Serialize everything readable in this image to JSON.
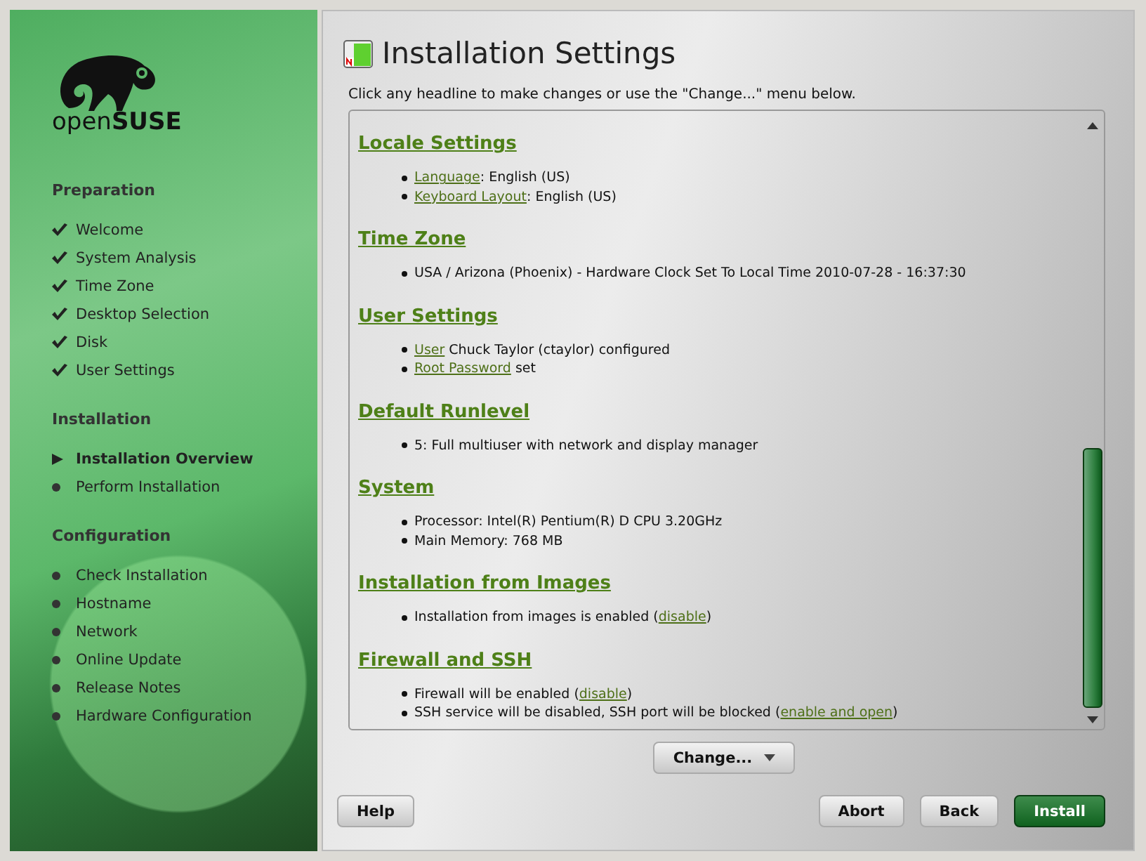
{
  "sidebar": {
    "logo_text": "open**SUSE**",
    "groups": [
      {
        "title": "Preparation",
        "items": [
          {
            "label": "Welcome",
            "checked": true,
            "selected": false
          },
          {
            "label": "System Analysis",
            "checked": true,
            "selected": false
          },
          {
            "label": "Time Zone",
            "checked": true,
            "selected": false
          },
          {
            "label": "Desktop Selection",
            "checked": true,
            "selected": false
          },
          {
            "label": "Disk",
            "checked": true,
            "selected": false
          },
          {
            "label": "User Settings",
            "checked": true,
            "selected": false
          }
        ]
      },
      {
        "title": "Installation",
        "items": [
          {
            "label": "Installation Overview",
            "checked": false,
            "selected": true
          },
          {
            "label": "Perform Installation",
            "checked": false,
            "selected": false
          }
        ]
      },
      {
        "title": "Configuration",
        "items": [
          {
            "label": "Check Installation",
            "checked": false,
            "selected": false
          },
          {
            "label": "Hostname",
            "checked": false,
            "selected": false
          },
          {
            "label": "Network",
            "checked": false,
            "selected": false
          },
          {
            "label": "Online Update",
            "checked": false,
            "selected": false
          },
          {
            "label": "Release Notes",
            "checked": false,
            "selected": false
          },
          {
            "label": "Hardware Configuration",
            "checked": false,
            "selected": false
          }
        ]
      }
    ]
  },
  "title": "Installation Settings",
  "hint": "Click any headline to make changes or use the \"Change...\" menu below.",
  "sections": [
    {
      "heading": "Locale Settings",
      "items": [
        [
          {
            "text": "Language",
            "link": true
          },
          {
            "text": ": English (US)",
            "link": false
          }
        ],
        [
          {
            "text": "Keyboard Layout",
            "link": true
          },
          {
            "text": ": English (US)",
            "link": false
          }
        ]
      ]
    },
    {
      "heading": "Time Zone",
      "items": [
        [
          {
            "text": "USA / Arizona (Phoenix) - Hardware Clock Set To Local Time 2010-07-28 - 16:37:30",
            "link": false
          }
        ]
      ]
    },
    {
      "heading": "User Settings",
      "items": [
        [
          {
            "text": "User",
            "link": true
          },
          {
            "text": " Chuck Taylor (ctaylor) configured",
            "link": false
          }
        ],
        [
          {
            "text": "Root Password",
            "link": true
          },
          {
            "text": " set",
            "link": false
          }
        ]
      ]
    },
    {
      "heading": "Default Runlevel",
      "items": [
        [
          {
            "text": "5: Full multiuser with network and display manager",
            "link": false
          }
        ]
      ]
    },
    {
      "heading": "System",
      "items": [
        [
          {
            "text": "Processor: Intel(R) Pentium(R) D CPU 3.20GHz",
            "link": false
          }
        ],
        [
          {
            "text": "Main Memory: 768 MB",
            "link": false
          }
        ]
      ]
    },
    {
      "heading": "Installation from Images",
      "items": [
        [
          {
            "text": "Installation from images is enabled (",
            "link": false
          },
          {
            "text": "disable",
            "link": true
          },
          {
            "text": ")",
            "link": false
          }
        ]
      ]
    },
    {
      "heading": "Firewall and SSH",
      "items": [
        [
          {
            "text": "Firewall will be enabled (",
            "link": false
          },
          {
            "text": "disable",
            "link": true
          },
          {
            "text": ")",
            "link": false
          }
        ],
        [
          {
            "text": "SSH service will be disabled, SSH port will be blocked (",
            "link": false
          },
          {
            "text": "enable and open",
            "link": true
          },
          {
            "text": ")",
            "link": false
          }
        ]
      ]
    }
  ],
  "change_button": "Change...",
  "buttons": [
    {
      "label": "Help",
      "kind": "plain"
    },
    {
      "label": "Abort",
      "kind": "plain"
    },
    {
      "label": "Back",
      "kind": "plain"
    },
    {
      "label": "Install",
      "kind": "primary"
    }
  ]
}
